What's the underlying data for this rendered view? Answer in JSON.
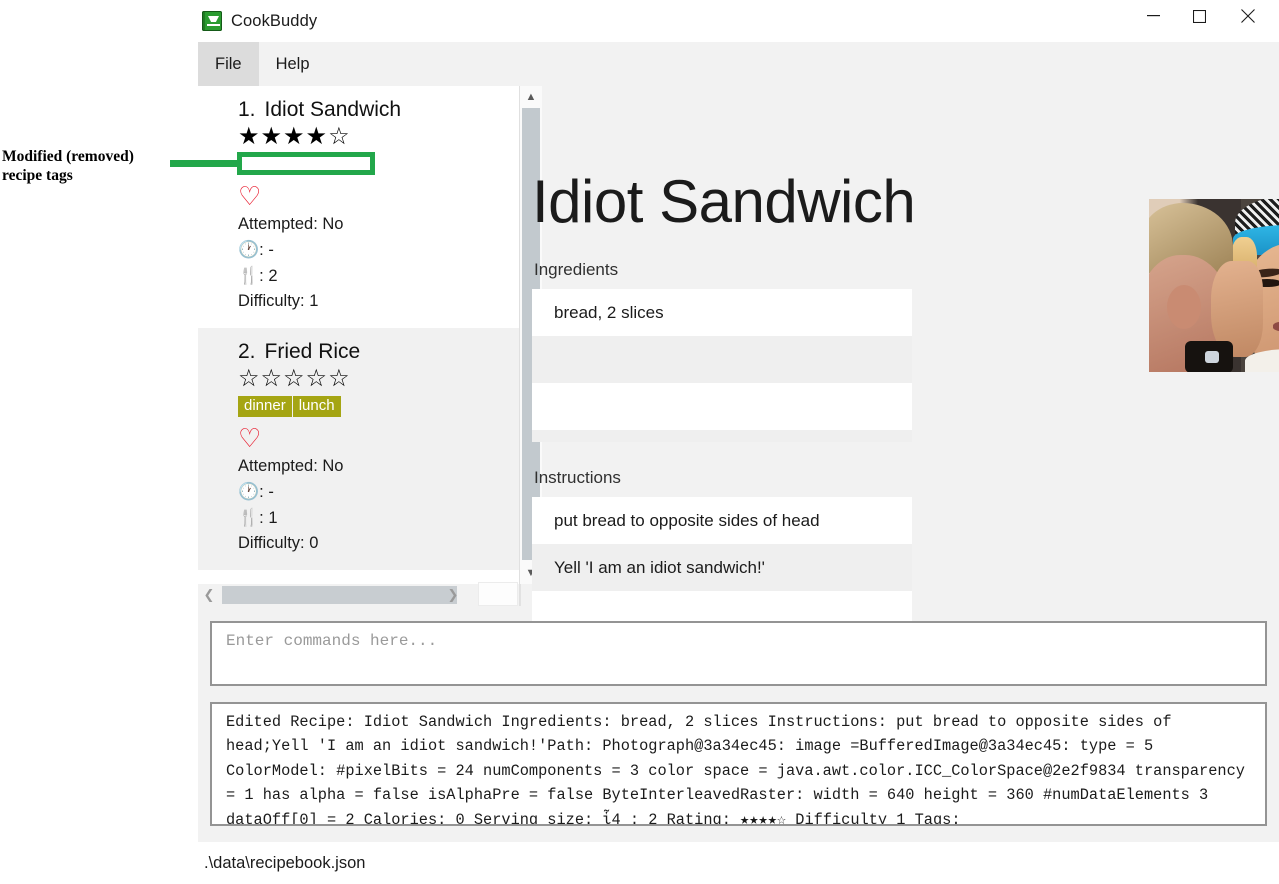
{
  "window": {
    "title": "CookBuddy",
    "icon": "cookbook-icon",
    "controls": {
      "minimize": "minimize-icon",
      "maximize": "maximize-icon",
      "close": "close-icon"
    }
  },
  "menu": {
    "items": [
      {
        "label": "File",
        "active": true
      },
      {
        "label": "Help",
        "active": false
      }
    ]
  },
  "annotation": {
    "line1": "Modified (removed)",
    "line2": "recipe tags",
    "color": "#22a74a"
  },
  "recipe_list": [
    {
      "number": "1.",
      "name": "Idiot Sandwich",
      "stars": "★★★★☆",
      "tags": [],
      "favorite_icon": "♡",
      "attempted": "Attempted: No",
      "time": ": -",
      "servings": ": 2",
      "difficulty": "Difficulty: 1"
    },
    {
      "number": "2.",
      "name": "Fried Rice",
      "stars": "☆☆☆☆☆",
      "tags": [
        "dinner",
        "lunch"
      ],
      "favorite_icon": "♡",
      "attempted": "Attempted: No",
      "time": ": -",
      "servings": ": 1",
      "difficulty": "Difficulty: 0"
    }
  ],
  "detail": {
    "heading": "Idiot Sandwich",
    "ingredients_label": "Ingredients",
    "ingredients": [
      "bread, 2 slices",
      "",
      "",
      ""
    ],
    "instructions_label": "Instructions",
    "instructions": [
      "put bread to opposite sides of head",
      "Yell 'I am an idiot sandwich!'",
      "",
      ""
    ],
    "photo_alt": "recipe-photo"
  },
  "command": {
    "placeholder": "Enter commands here...",
    "value": ""
  },
  "console": {
    "text": "Edited Recipe: Idiot Sandwich Ingredients: bread, 2 slices Instructions: put bread to opposite sides of head;Yell 'I am an idiot sandwich!'Path: Photograph@3a34ec45: image =BufferedImage@3a34ec45: type = 5 ColorModel: #pixelBits = 24 numComponents = 3 color space = java.awt.color.ICC_ColorSpace@2e2f9834 transparency = 1 has alpha = false isAlphaPre = false ByteInterleavedRaster: width = 640 height = 360 #numDataElements 3 dataOff[0] = 2 Calories: 0 Serving size: ἷ4 : 2 Rating: ★★★★☆ Difficulty 1 Tags:"
  },
  "status": {
    "path": ".\\data\\recipebook.json"
  },
  "colors": {
    "tag_bg": "#a5a513",
    "heart": "#e8192c",
    "annotation_green": "#22a74a",
    "panel_bg": "#f2f2f2"
  }
}
